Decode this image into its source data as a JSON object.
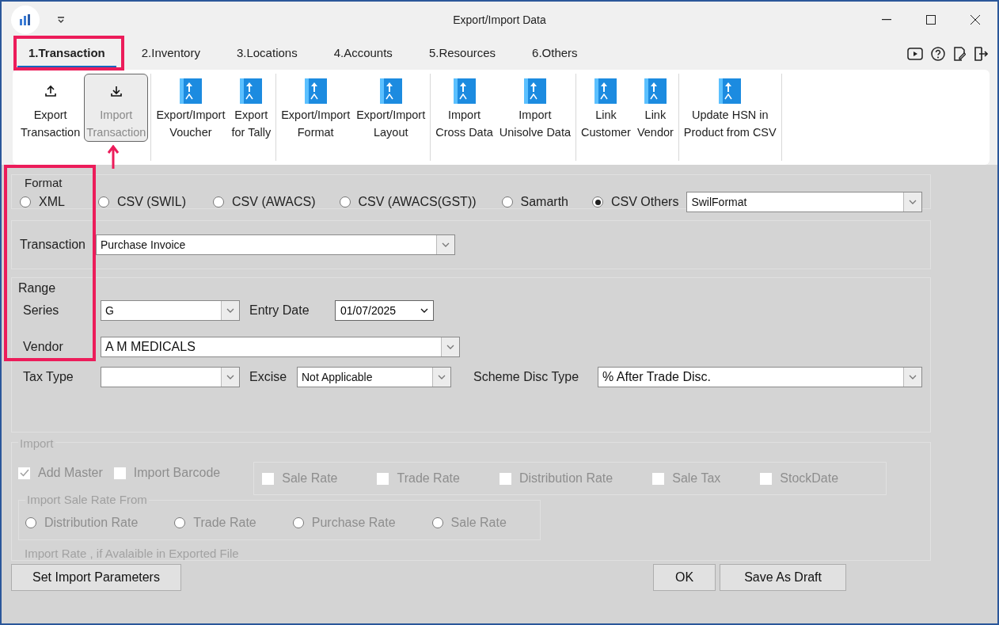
{
  "window": {
    "title": "Export/Import Data"
  },
  "tabs": [
    {
      "label": "1.Transaction",
      "selected": true
    },
    {
      "label": "2.Inventory",
      "selected": false
    },
    {
      "label": "3.Locations",
      "selected": false
    },
    {
      "label": "4.Accounts",
      "selected": false
    },
    {
      "label": "5.Resources",
      "selected": false
    },
    {
      "label": "6.Others",
      "selected": false
    }
  ],
  "ribbon": {
    "groups": [
      {
        "buttons": [
          {
            "lines": [
              "Export",
              "Transaction"
            ],
            "kind": "export",
            "selected": false
          },
          {
            "lines": [
              "Import",
              "Transaction"
            ],
            "kind": "import",
            "selected": true
          }
        ]
      },
      {
        "buttons": [
          {
            "lines": [
              "Export/Import",
              "Voucher"
            ],
            "kind": "book",
            "selected": false
          },
          {
            "lines": [
              "Export",
              "for Tally"
            ],
            "kind": "book",
            "selected": false
          }
        ]
      },
      {
        "buttons": [
          {
            "lines": [
              "Export/Import",
              "Format"
            ],
            "kind": "book",
            "selected": false
          },
          {
            "lines": [
              "Export/Import",
              "Layout"
            ],
            "kind": "book",
            "selected": false
          }
        ]
      },
      {
        "buttons": [
          {
            "lines": [
              "Import",
              "Cross Data"
            ],
            "kind": "book",
            "selected": false
          },
          {
            "lines": [
              "Import",
              "Unisolve Data"
            ],
            "kind": "book",
            "selected": false
          }
        ]
      },
      {
        "buttons": [
          {
            "lines": [
              "Link",
              "Customer"
            ],
            "kind": "book",
            "selected": false
          },
          {
            "lines": [
              "Link",
              "Vendor"
            ],
            "kind": "book",
            "selected": false
          }
        ]
      },
      {
        "buttons": [
          {
            "lines": [
              "Update HSN in",
              "Product from CSV"
            ],
            "kind": "book",
            "selected": false
          }
        ]
      }
    ]
  },
  "format": {
    "title": "Format",
    "options": [
      {
        "label": "XML",
        "selected": false
      },
      {
        "label": "CSV (SWIL)",
        "selected": false
      },
      {
        "label": "CSV (AWACS)",
        "selected": false
      },
      {
        "label": "CSV (AWACS(GST))",
        "selected": false
      },
      {
        "label": "Samarth",
        "selected": false
      },
      {
        "label": "CSV Others",
        "selected": true
      }
    ],
    "format_name": "SwilFormat"
  },
  "transaction": {
    "label": "Transaction",
    "value": "Purchase Invoice"
  },
  "range": {
    "title": "Range",
    "series": {
      "label": "Series",
      "value": "G"
    },
    "entry_date": {
      "label": "Entry Date",
      "value": "01/07/2025"
    },
    "vendor": {
      "label": "Vendor",
      "value": "A M MEDICALS"
    },
    "tax_type": {
      "label": "Tax Type"
    },
    "excise": {
      "label": "Excise",
      "value": "Not Applicable"
    },
    "scheme_disc_type": {
      "label": "Scheme Disc Type",
      "value": "% After Trade Disc."
    }
  },
  "import": {
    "title": "Import",
    "disabled": true,
    "options": [
      {
        "label": "Add Master",
        "checked": true
      },
      {
        "label": "Import Barcode",
        "checked": false
      }
    ],
    "rate_options": [
      {
        "label": "Sale Rate",
        "checked": false
      },
      {
        "label": "Trade Rate",
        "checked": false
      },
      {
        "label": "Distribution Rate",
        "checked": false
      },
      {
        "label": "Sale Tax",
        "checked": false
      },
      {
        "label": "StockDate",
        "checked": false
      }
    ],
    "sale_rate_from": {
      "title": "Import Sale Rate From",
      "options": [
        {
          "label": "Distribution Rate",
          "selected": false
        },
        {
          "label": "Trade Rate",
          "selected": false
        },
        {
          "label": "Purchase Rate",
          "selected": false
        },
        {
          "label": "Sale Rate",
          "selected": false
        }
      ]
    },
    "note": "Import Rate , if Avalaible in Exported File"
  },
  "left_buttons": [
    {
      "label": "Set Import Parameters"
    }
  ],
  "right_buttons": [
    {
      "label": "OK"
    },
    {
      "label": "Save As Draft"
    }
  ]
}
